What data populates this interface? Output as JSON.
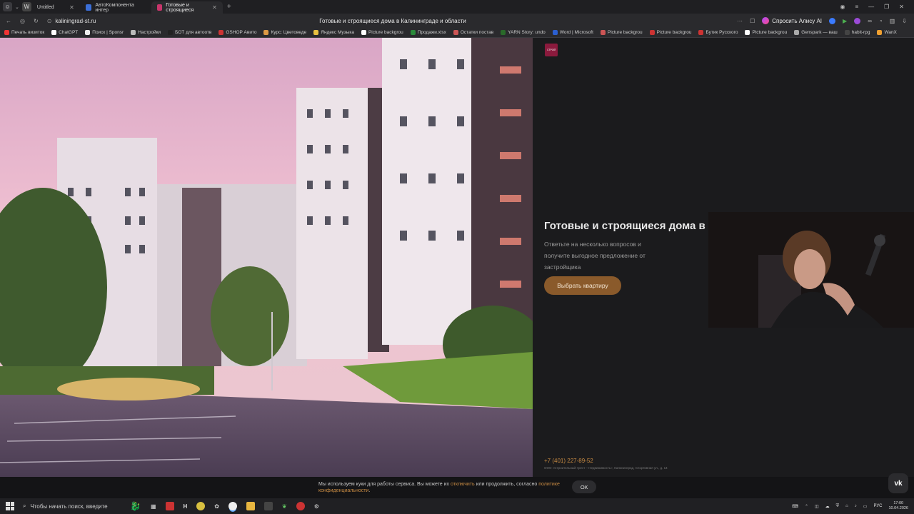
{
  "browser": {
    "tabs": [
      {
        "title": "Untitled",
        "favicon_color": "#6a6a6a",
        "active": false
      },
      {
        "title": "АвтоКомпонента интер",
        "favicon_color": "#3b6fd8",
        "active": false
      },
      {
        "title": "Готовые и строящиеся",
        "favicon_color": "#c8356b",
        "active": true
      }
    ],
    "url": "kaliningrad-st.ru",
    "page_title": "Готовые и строящиеся дома в Калининграде и области",
    "alice_label": "Спросить Алису AI",
    "bookmarks": [
      "Печать визиток",
      "ChatGPT",
      "Поиск | Sponsr",
      "Настройки",
      "БОТ для автоотв",
      "GSHOP Авито",
      "Курс: Цветоведе",
      "Яндекс Музыка",
      "Picture backgrou",
      "Продажи.xlsx",
      "Остатки постав",
      "YARN Story: undo",
      "Word | Microsoft",
      "Picture backgrou",
      "Picture backgrou",
      "Бутик Русского",
      "Picture backgrou",
      "Genspark — ваш",
      "habit-rpg",
      "WanX"
    ]
  },
  "site": {
    "logo_text": "СТРОЙ",
    "hero_title": "Готовые и строящиеся дома в Ка",
    "hero_subtitle": "Ответьте на несколько вопросов и получите выгодное предложение от застройщика",
    "cta_label": "Выбрать квартиру",
    "phone": "+7 (401) 227-89-52",
    "legal": "ООО «Строительный трест – Недвижимость», Калининград, Спортивная ул., д. 14",
    "accent_color": "#8a5a2b",
    "logo_color": "#8b1a3d"
  },
  "cookie": {
    "text_before": "Мы используем куки для работы сервиса. Вы можете их ",
    "disable_link": "отключить",
    "text_middle": " или продолжить, согласно ",
    "policy_link": "политике конфиденциальности",
    "text_after": ".",
    "ok_label": "ОК"
  },
  "taskbar": {
    "search_placeholder": "Чтобы начать поиск, введите",
    "lang": "РУС",
    "time": "17:00",
    "date": "10.04.2026"
  }
}
